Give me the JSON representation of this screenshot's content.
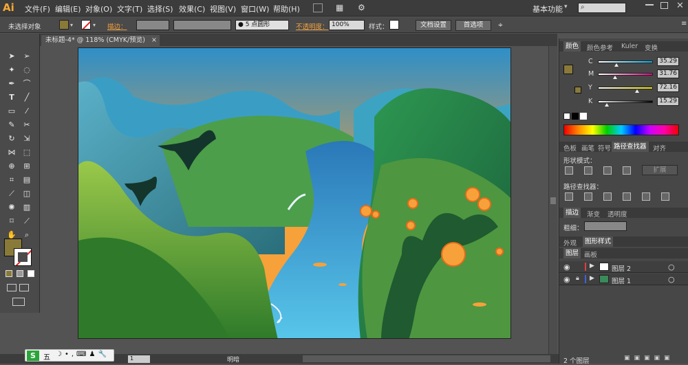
{
  "menu": {
    "logo": "Ai",
    "items": [
      "文件(F)",
      "编辑(E)",
      "对象(O)",
      "文字(T)",
      "选择(S)",
      "效果(C)",
      "视图(V)",
      "窗口(W)",
      "帮助(H)"
    ],
    "workspace": "基本功能",
    "search_placeholder": ""
  },
  "control": {
    "no_selection": "未选择对象",
    "stroke_label": "描边：",
    "brush_label": "5 点圆形",
    "opacity_label": "不透明度：",
    "opacity_value": "100%",
    "style_label": "样式：",
    "doc_setup": "文档设置",
    "preferences": "首选项"
  },
  "document": {
    "tab_title": "未标题-4* @ 118% (CMYK/预览)",
    "zoom": "118%"
  },
  "colors": {
    "fill": "#8a7a3a",
    "artboard_sky_top": "#2f8fc7",
    "sunset": "#f7a13a",
    "accent": "#f7a833"
  },
  "panels": {
    "color_tabs": [
      "颜色",
      "颜色参考",
      "Kuler",
      "变换"
    ],
    "cmyk": [
      {
        "channel": "C",
        "value": "35.29",
        "fraction": 0.35
      },
      {
        "channel": "M",
        "value": "31.76",
        "fraction": 0.32
      },
      {
        "channel": "Y",
        "value": "72.16",
        "fraction": 0.72
      },
      {
        "channel": "K",
        "value": "15.29",
        "fraction": 0.15
      }
    ],
    "pathfinder_tabs": [
      "色板",
      "画笔",
      "符号",
      "路径查找器",
      "对齐"
    ],
    "shape_modes_label": "形状模式：",
    "expand_button": "扩展",
    "pathfinders_label": "路径查找器：",
    "stroke_tabs": [
      "描边",
      "渐变",
      "透明度"
    ],
    "weight_label": "粗细：",
    "appearance_tabs": [
      "外观",
      "图形样式"
    ],
    "layers_tabs": [
      "图层",
      "画板"
    ],
    "layers": [
      {
        "name": "图层 2"
      },
      {
        "name": "图层 1"
      }
    ],
    "layers_count": "2 个图层"
  },
  "status": {
    "page": "1",
    "mode": "明暗"
  },
  "ime": {
    "label": "五"
  }
}
